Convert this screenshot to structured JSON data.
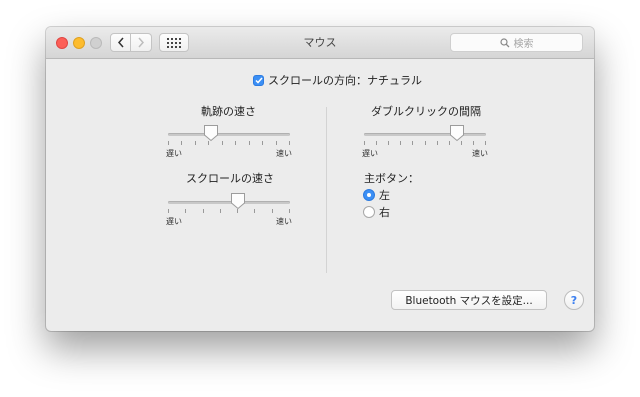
{
  "window": {
    "title": "マウス"
  },
  "toolbar": {
    "search_placeholder": "検索",
    "back_icon": "chevron-left-icon",
    "forward_icon": "chevron-right-icon",
    "grid_icon": "grid-icon"
  },
  "scroll_direction": {
    "label": "スクロールの方向：ナチュラル",
    "checked": true
  },
  "tracking_speed": {
    "label": "軌跡の速さ",
    "slow": "遅い",
    "fast": "速い",
    "value_fraction": 0.35,
    "ticks": 10
  },
  "scroll_speed": {
    "label": "スクロールの速さ",
    "slow": "遅い",
    "fast": "速い",
    "value_fraction": 0.57,
    "ticks": 8
  },
  "double_click": {
    "label": "ダブルクリックの間隔",
    "slow": "遅い",
    "fast": "速い",
    "value_fraction": 0.76,
    "ticks": 11
  },
  "primary_button": {
    "label": "主ボタン：",
    "options": [
      {
        "label": "左",
        "selected": true
      },
      {
        "label": "右",
        "selected": false
      }
    ]
  },
  "bluetooth_button": {
    "label": "Bluetooth マウスを設定..."
  },
  "help": {
    "label": "?"
  },
  "colors": {
    "accent": "#3b8ff5",
    "close": "#fc5f57",
    "minimize": "#fdbc2e"
  }
}
